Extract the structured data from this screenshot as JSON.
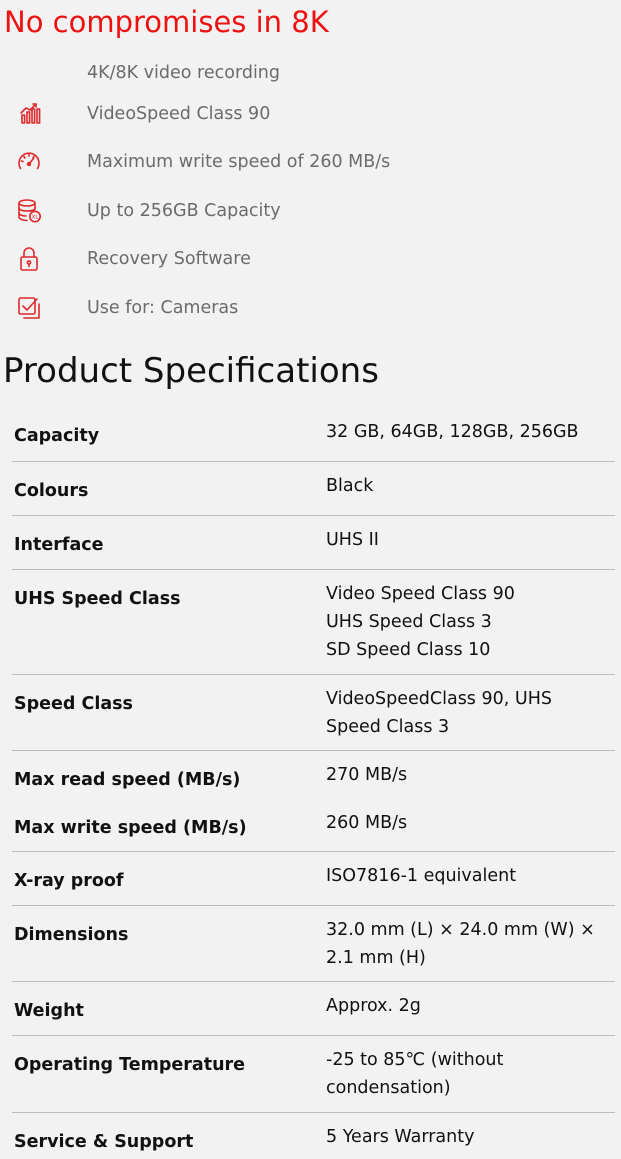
{
  "headline": "No compromises in 8K",
  "accent_color": "#ee1111",
  "features": [
    {
      "icon": "none",
      "text": "4K/8K video recording"
    },
    {
      "icon": "bar-chart-icon",
      "text": "VideoSpeed Class 90"
    },
    {
      "icon": "speedometer-icon",
      "text": "Maximum write speed of 260 MB/s"
    },
    {
      "icon": "database-xl-icon",
      "text": "Up to 256GB Capacity"
    },
    {
      "icon": "lock-icon",
      "text": "Recovery Software"
    },
    {
      "icon": "checkbox-icon",
      "text": "Use for: Cameras"
    }
  ],
  "specs_title": "Product Specifications",
  "specs": [
    {
      "label": "Capacity",
      "value": [
        "32 GB, 64GB, 128GB, 256GB"
      ]
    },
    {
      "label": "Colours",
      "value": [
        "Black"
      ]
    },
    {
      "label": "Interface",
      "value": [
        "UHS II"
      ]
    },
    {
      "label": "UHS Speed Class",
      "value": [
        "Video Speed Class 90",
        "UHS Speed Class 3",
        "SD Speed Class 10"
      ]
    },
    {
      "label": "Speed Class",
      "value": [
        "VideoSpeedClass 90, UHS",
        "Speed Class 3"
      ]
    },
    {
      "label": "Max read speed (MB/s)",
      "value": [
        "270 MB/s"
      ],
      "label2": "Max write speed (MB/s)",
      "value2": [
        "260 MB/s"
      ]
    },
    {
      "label": "X-ray proof",
      "value": [
        "ISO7816-1 equivalent"
      ]
    },
    {
      "label": "Dimensions",
      "value": [
        "32.0 mm (L) × 24.0 mm (W) ×",
        "2.1 mm (H)"
      ]
    },
    {
      "label": "Weight",
      "value": [
        "Approx. 2g"
      ]
    },
    {
      "label": "Operating Temperature",
      "value": [
        "-25 to 85℃ (without",
        "condensation)"
      ]
    },
    {
      "label": "Service & Support",
      "value": [
        "5 Years Warranty"
      ]
    }
  ]
}
